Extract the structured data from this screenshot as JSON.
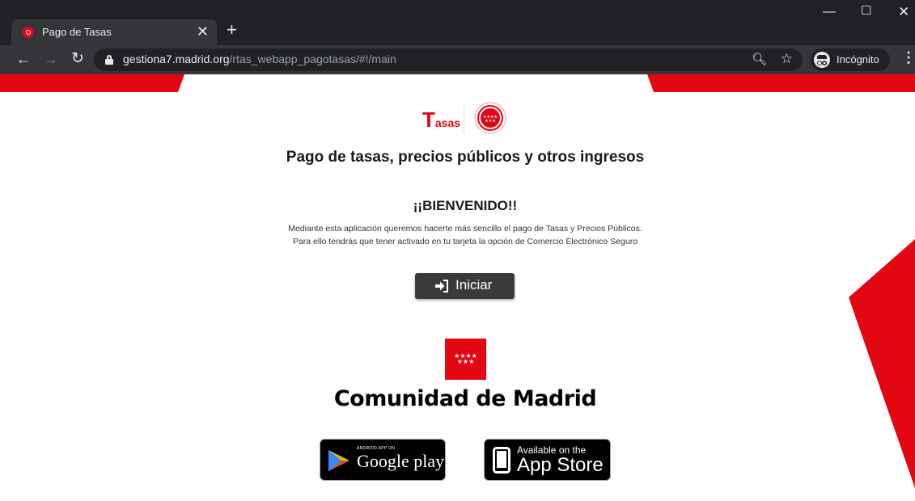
{
  "browser": {
    "tab": {
      "title": "Pago de Tasas"
    },
    "address": {
      "host": "gestiona7.madrid.org",
      "path": "/rtas_webapp_pagotasas/#!/main"
    },
    "incognito_label": "Incógnito"
  },
  "colors": {
    "brand_red": "#e30613",
    "button_dark": "#3a3a3a",
    "chrome_dark": "#202124"
  },
  "logo": {
    "text_big": "T",
    "text_small": "asas"
  },
  "page": {
    "title": "Pago de tasas, precios públicos y otros ingresos",
    "welcome": "¡¡BIENVENIDO!!",
    "description": "Mediante esta aplicación queremos hacerte más sencillo el pago de Tasas y Precios Públicos. Para ello tendrás que tener activado en tu tarjeta la opción de Comercio Electrónico Seguro",
    "start_button": "Iniciar",
    "org_name": "Comunidad de Madrid"
  },
  "stores": {
    "google_small": "ANDROID APP ON",
    "google_big": "Google play",
    "apple_small": "Available on the",
    "apple_big": "App Store"
  },
  "icons": [
    "back-arrow-icon",
    "forward-arrow-icon",
    "reload-icon",
    "lock-icon",
    "zoom-icon",
    "star-icon",
    "incognito-icon",
    "kebab-menu-icon",
    "login-icon",
    "android-play-icon",
    "apple-icon"
  ]
}
